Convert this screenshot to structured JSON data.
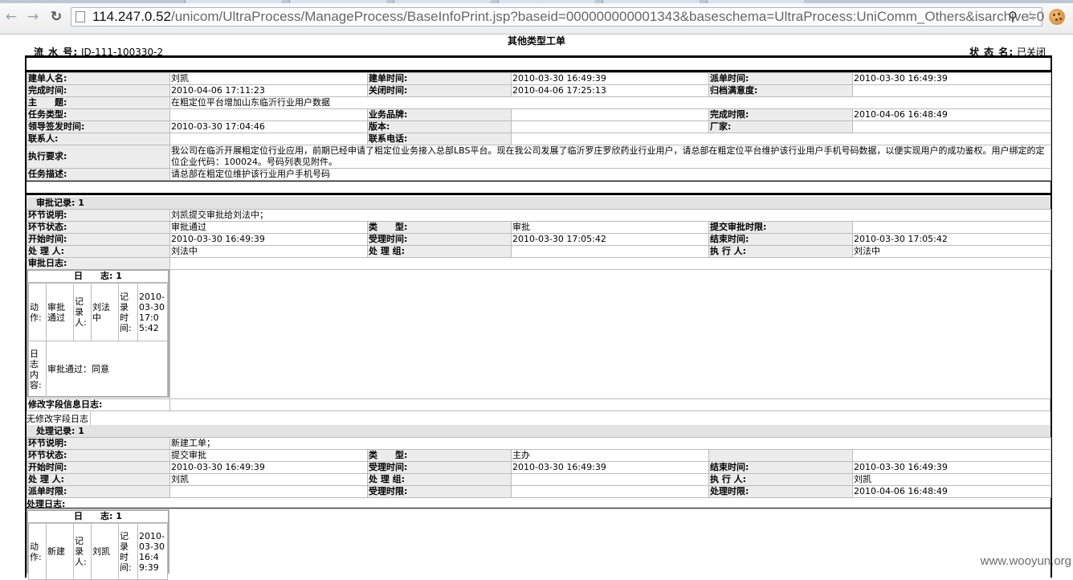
{
  "browser": {
    "url_host": "114.247.0.52",
    "url_path": "/unicom/UltraProcess/ManageProcess/BaseInfoPrint.jsp?baseid=000000000001343&baseschema=UltraProcess:UniComm_Others&isarchive=0"
  },
  "doc": {
    "title": "其他类型工单",
    "serial_label": "流 水 号:",
    "serial_value": "ID-111-100330-2",
    "status_label": "状 态 名:",
    "status_value": "已关闭"
  },
  "info": {
    "creator_label": "建单人名:",
    "creator": "刘凯",
    "create_time_label": "建单时间:",
    "create_time": "2010-03-30 16:49:39",
    "dispatch_time_label": "派单时间:",
    "dispatch_time": "2010-03-30 16:49:39",
    "finish_time_label": "完成时间:",
    "finish_time": "2010-04-06 17:11:23",
    "close_time_label": "关闭时间:",
    "close_time": "2010-04-06 17:25:13",
    "satisfaction_label": "归档满意度:",
    "satisfaction": "",
    "subject_label": "主　　题:",
    "subject": "在粗定位平台增加山东临沂行业用户数据",
    "task_type_label": "任务类型:",
    "task_type": "",
    "brand_label": "业务品牌:",
    "brand": "",
    "deadline_label": "完成时限:",
    "deadline": "2010-04-06 16:48:49",
    "sign_time_label": "领导签发时间:",
    "sign_time": "2010-03-30 17:04:46",
    "version_label": "版本:",
    "version": "",
    "vendor_label": "厂家:",
    "vendor": "",
    "contact_label": "联系人:",
    "contact": "",
    "phone_label": "联系电话:",
    "phone": "",
    "requirement_label": "执行要求:",
    "requirement": "我公司在临沂开展粗定位行业应用，前期已经申请了粗定位业务接入总部LBS平台。现在我公司发展了临沂罗庄罗欣药业行业用户，请总部在粗定位平台维护该行业用户手机号码数据，以便实现用户的成功鉴权。用户绑定的定位企业代码：100024。号码列表见附件。",
    "description_label": "任务描述:",
    "description": "请总部在粗定位维护该行业用户手机号码"
  },
  "approval": {
    "section_title": "审批记录: 1",
    "step_note_label": "环节说明:",
    "step_note": "刘凯提交审批给刘法中；",
    "step_state_label": "环节状态:",
    "step_state": "审批通过",
    "type_label": "类　　型:",
    "type": "审批",
    "submit_deadline_label": "提交审批时限:",
    "submit_deadline": "",
    "start_label": "开始时间:",
    "start": "2010-03-30 16:49:39",
    "accept_label": "受理时间:",
    "accept": "2010-03-30 17:05:42",
    "end_label": "结束时间:",
    "end": "2010-03-30 17:05:42",
    "handler_label": "处 理 人:",
    "handler": "刘法中",
    "group_label": "处 理 组:",
    "group": "",
    "executor_label": "执 行 人:",
    "executor": "刘法中",
    "log_label": "审批日志:",
    "log": {
      "header": "日　　志: 1",
      "action_label": "动作:",
      "action": "审批通过",
      "recorder_label": "记录人:",
      "recorder": "刘法中",
      "time_label": "记录时间:",
      "time": "2010-03-30 17:05:42",
      "content_label": "日志内容:",
      "content": "审批通过：同意"
    }
  },
  "field_log": {
    "label": "修改字段信息日志:",
    "empty": "无修改字段日志"
  },
  "processing": {
    "section_title": "处理记录: 1",
    "step_note_label": "环节说明:",
    "step_note": "新建工单；",
    "step_state_label": "环节状态:",
    "step_state": "提交审批",
    "type_label": "类　　型:",
    "type": "主办",
    "start_label": "开始时间:",
    "start": "2010-03-30 16:49:39",
    "accept_label": "受理时间:",
    "accept": "2010-03-30 16:49:39",
    "end_label": "结束时间:",
    "end": "2010-03-30 16:49:39",
    "handler_label": "处 理 人:",
    "handler": "刘凯",
    "group_label": "处 理 组:",
    "group": "",
    "executor_label": "执 行 人:",
    "executor": "刘凯",
    "dispatch_deadline_label": "派单时限:",
    "dispatch_deadline": "",
    "accept_deadline_label": "受理时限:",
    "accept_deadline": "",
    "process_deadline_label": "处理时限:",
    "process_deadline": "2010-04-06 16:48:49",
    "log_label": "处理日志:",
    "log": {
      "header": "日　　志: 1",
      "action_label": "动作:",
      "action": "新建",
      "recorder_label": "记录人:",
      "recorder": "刘凯",
      "time_label": "记录时间:",
      "time": "2010-03-30 16:49:39"
    }
  },
  "watermark": "www.wooyun.org"
}
